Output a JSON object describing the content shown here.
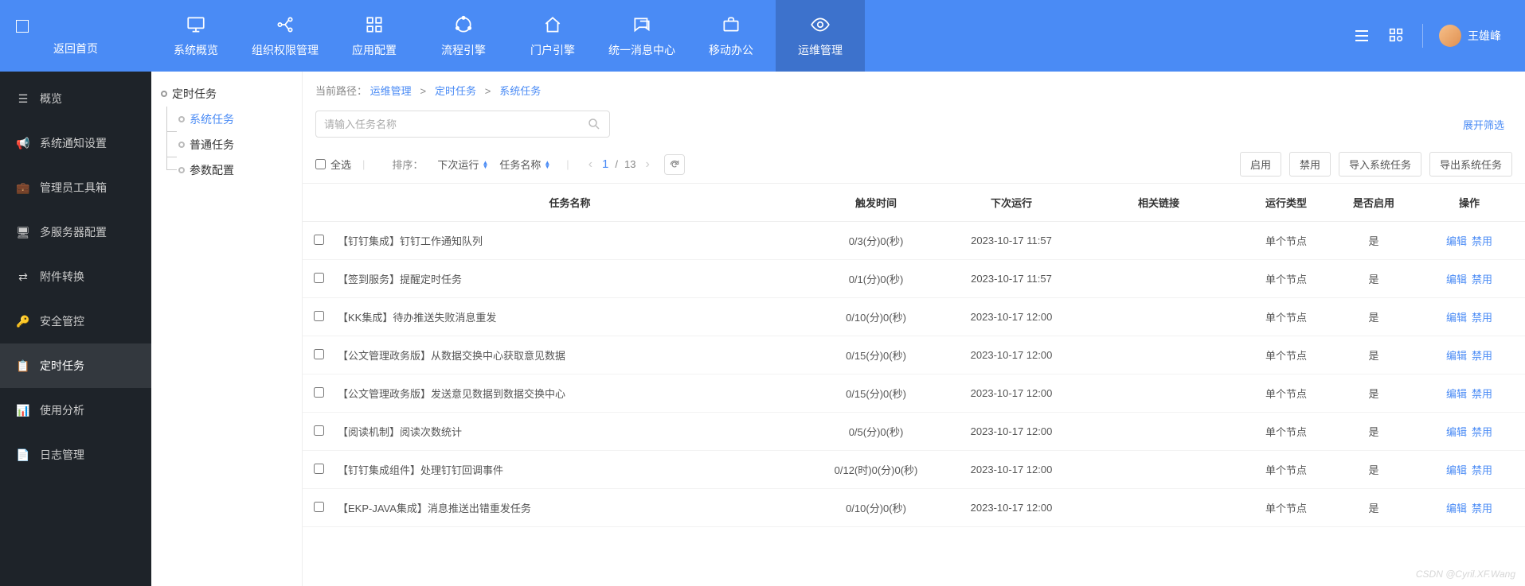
{
  "home_link": "返回首页",
  "top_nav": [
    {
      "label": "系统概览"
    },
    {
      "label": "组织权限管理"
    },
    {
      "label": "应用配置"
    },
    {
      "label": "流程引擎"
    },
    {
      "label": "门户引擎"
    },
    {
      "label": "统一消息中心"
    },
    {
      "label": "移动办公"
    },
    {
      "label": "运维管理"
    }
  ],
  "user_name": "王雄峰",
  "left_nav": [
    {
      "label": "概览"
    },
    {
      "label": "系统通知设置"
    },
    {
      "label": "管理员工具箱"
    },
    {
      "label": "多服务器配置"
    },
    {
      "label": "附件转换"
    },
    {
      "label": "安全管控"
    },
    {
      "label": "定时任务"
    },
    {
      "label": "使用分析"
    },
    {
      "label": "日志管理"
    }
  ],
  "tree": {
    "root": "定时任务",
    "children": [
      "系统任务",
      "普通任务",
      "参数配置"
    ]
  },
  "breadcrumb": {
    "prefix": "当前路径：",
    "parts": [
      "运维管理",
      "定时任务",
      "系统任务"
    ],
    "sep": ">"
  },
  "search_placeholder": "请输入任务名称",
  "expand_filter": "展开筛选",
  "select_all": "全选",
  "sort_label": "排序：",
  "sort_options": [
    "下次运行",
    "任务名称"
  ],
  "pager": {
    "current": "1",
    "total": "13",
    "sep": "/"
  },
  "action_buttons": [
    "启用",
    "禁用",
    "导入系统任务",
    "导出系统任务"
  ],
  "columns": {
    "name": "任务名称",
    "trigger": "触发时间",
    "next": "下次运行",
    "link": "相关链接",
    "type": "运行类型",
    "enable": "是否启用",
    "op": "操作"
  },
  "op_links": {
    "edit": "编辑",
    "disable": "禁用"
  },
  "rows": [
    {
      "name": "【钉钉集成】钉钉工作通知队列",
      "trigger": "0/3(分)0(秒)",
      "next": "2023-10-17 11:57",
      "link": "",
      "type": "单个节点",
      "enable": "是"
    },
    {
      "name": "【签到服务】提醒定时任务",
      "trigger": "0/1(分)0(秒)",
      "next": "2023-10-17 11:57",
      "link": "",
      "type": "单个节点",
      "enable": "是"
    },
    {
      "name": "【KK集成】待办推送失败消息重发",
      "trigger": "0/10(分)0(秒)",
      "next": "2023-10-17 12:00",
      "link": "",
      "type": "单个节点",
      "enable": "是"
    },
    {
      "name": "【公文管理政务版】从数据交换中心获取意见数据",
      "trigger": "0/15(分)0(秒)",
      "next": "2023-10-17 12:00",
      "link": "",
      "type": "单个节点",
      "enable": "是"
    },
    {
      "name": "【公文管理政务版】发送意见数据到数据交换中心",
      "trigger": "0/15(分)0(秒)",
      "next": "2023-10-17 12:00",
      "link": "",
      "type": "单个节点",
      "enable": "是"
    },
    {
      "name": "【阅读机制】阅读次数统计",
      "trigger": "0/5(分)0(秒)",
      "next": "2023-10-17 12:00",
      "link": "",
      "type": "单个节点",
      "enable": "是"
    },
    {
      "name": "【钉钉集成组件】处理钉钉回调事件",
      "trigger": "0/12(时)0(分)0(秒)",
      "next": "2023-10-17 12:00",
      "link": "",
      "type": "单个节点",
      "enable": "是"
    },
    {
      "name": "【EKP-JAVA集成】消息推送出错重发任务",
      "trigger": "0/10(分)0(秒)",
      "next": "2023-10-17 12:00",
      "link": "",
      "type": "单个节点",
      "enable": "是"
    }
  ],
  "watermark": "CSDN @Cyril.XF.Wang"
}
